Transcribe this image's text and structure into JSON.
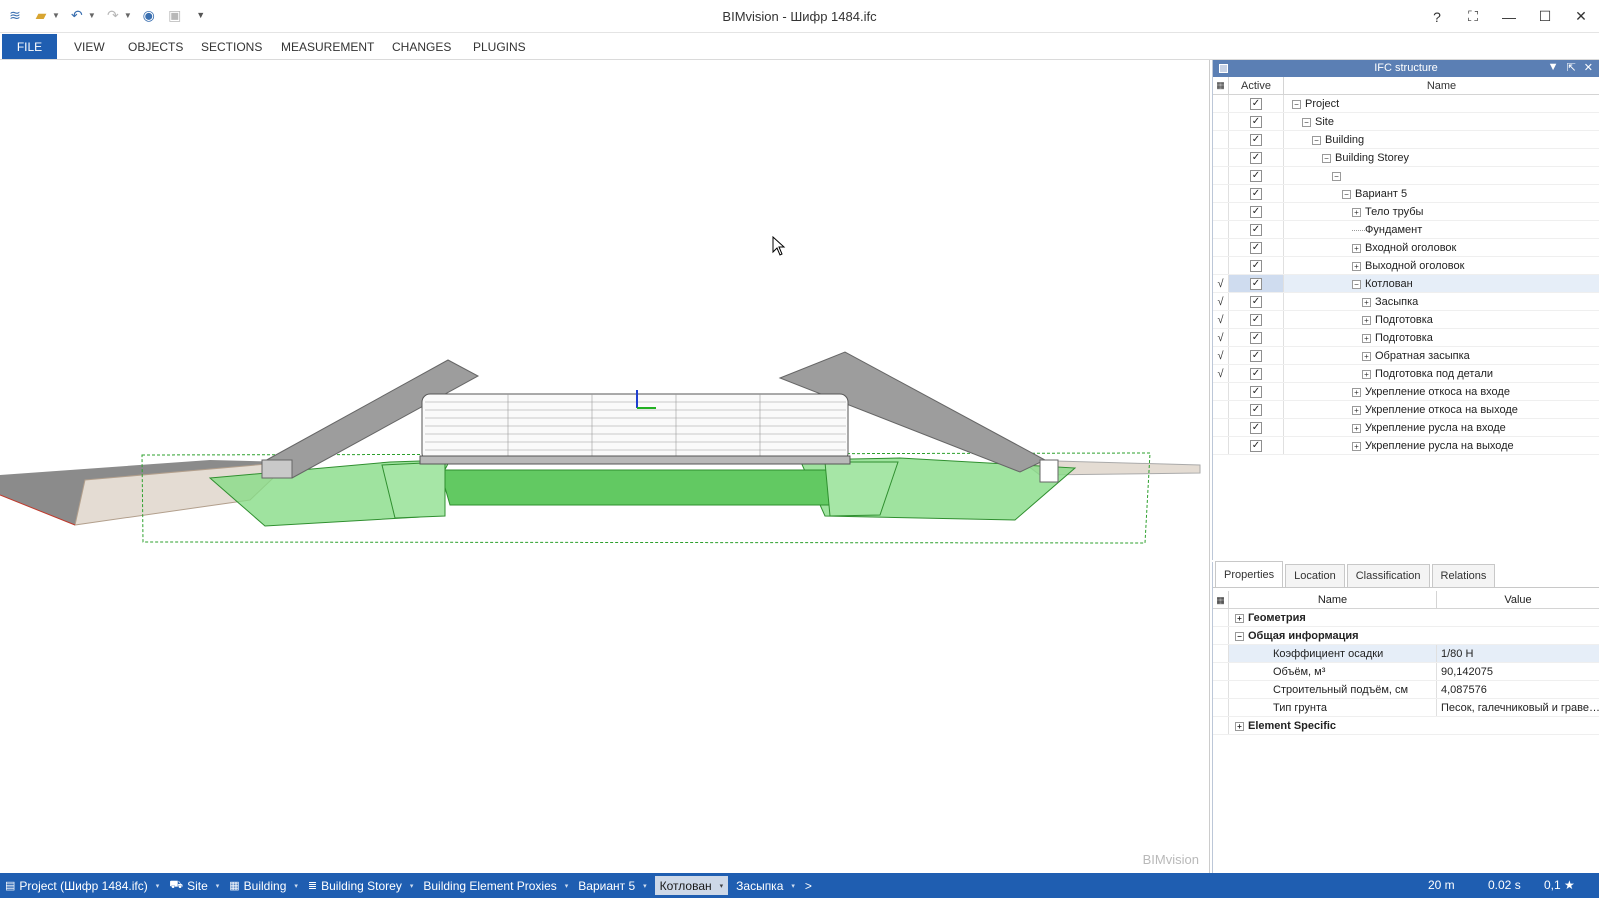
{
  "window": {
    "title": "BIMvision - Шифр 1484.ifc",
    "controls": {
      "help": "?",
      "fit": "⛶",
      "minimize": "—",
      "maximize": "☐",
      "close": "✕"
    }
  },
  "quick_access": [
    "app-icon",
    "open-icon",
    "undo-icon",
    "redo-icon",
    "settings-icon",
    "layout-icon",
    "customize-icon"
  ],
  "ribbon": {
    "file": "FILE",
    "tabs": [
      "VIEW",
      "OBJECTS",
      "SECTIONS",
      "MEASUREMENT",
      "CHANGES",
      "PLUGINS"
    ]
  },
  "viewport": {
    "watermark": "BIMvision"
  },
  "ifc_structure": {
    "title": "IFC structure",
    "columns": {
      "active": "Active",
      "name": "Name"
    },
    "rows": [
      {
        "name": "Project",
        "expander": "−",
        "mark": "",
        "active": true
      },
      {
        "name": "Site",
        "expander": "−",
        "mark": "",
        "active": true
      },
      {
        "name": "Building",
        "expander": "−",
        "mark": "",
        "active": true
      },
      {
        "name": "Building Storey",
        "expander": "−",
        "mark": "",
        "active": true
      },
      {
        "name": "",
        "expander": "−",
        "mark": "",
        "active": true
      },
      {
        "name": "Вариант 5",
        "expander": "−",
        "mark": "",
        "active": true
      },
      {
        "name": "Тело трубы",
        "expander": "+",
        "mark": "",
        "active": true
      },
      {
        "name": "Фундамент",
        "expander": "",
        "mark": "",
        "active": true
      },
      {
        "name": "Входной оголовок",
        "expander": "+",
        "mark": "",
        "active": true
      },
      {
        "name": "Выходной оголовок",
        "expander": "+",
        "mark": "",
        "active": true
      },
      {
        "name": "Котлован",
        "expander": "−",
        "mark": "√",
        "active": true
      },
      {
        "name": "Засыпка",
        "expander": "+",
        "mark": "√",
        "active": true
      },
      {
        "name": "Подготовка",
        "expander": "+",
        "mark": "√",
        "active": true
      },
      {
        "name": "Подготовка",
        "expander": "+",
        "mark": "√",
        "active": true
      },
      {
        "name": "Обратная засыпка",
        "expander": "+",
        "mark": "√",
        "active": true
      },
      {
        "name": "Подготовка под детали",
        "expander": "+",
        "mark": "√",
        "active": true
      },
      {
        "name": "Укрепление откоса на входе",
        "expander": "+",
        "mark": "",
        "active": true
      },
      {
        "name": "Укрепление откоса на выходе",
        "expander": "+",
        "mark": "",
        "active": true
      },
      {
        "name": "Укрепление русла на входе",
        "expander": "+",
        "mark": "",
        "active": true
      },
      {
        "name": "Укрепление русла на выходе",
        "expander": "+",
        "mark": "",
        "active": true
      }
    ]
  },
  "properties": {
    "tabs": [
      "Properties",
      "Location",
      "Classification",
      "Relations"
    ],
    "columns": {
      "name": "Name",
      "value": "Value"
    },
    "groups": [
      {
        "title": "Геометрия",
        "expander": "+",
        "items": []
      },
      {
        "title": "Общая информация",
        "expander": "−",
        "items": [
          {
            "name": "Коэффициент осадки",
            "value": "1/80 H"
          },
          {
            "name": "Объём, м³",
            "value": "90,142075"
          },
          {
            "name": "Строительный подъём, см",
            "value": "4,087576"
          },
          {
            "name": "Тип грунта",
            "value": "Песок, галечниковый и граве…"
          }
        ]
      },
      {
        "title": "Element Specific",
        "expander": "+",
        "items": []
      }
    ]
  },
  "statusbar": {
    "crumbs": [
      {
        "label": "Project (Шифр 1484.ifc)",
        "icon": "▤",
        "dd": "▾"
      },
      {
        "label": "Site",
        "icon": "⛟",
        "dd": "▾"
      },
      {
        "label": "Building",
        "icon": "▦",
        "dd": "▾"
      },
      {
        "label": "Building Storey",
        "icon": "≣",
        "dd": "▾"
      },
      {
        "label": "Building Element Proxies",
        "icon": "",
        "dd": "▾"
      },
      {
        "label": "Вариант 5",
        "icon": "",
        "dd": "▾"
      },
      {
        "label": "Котлован",
        "icon": "",
        "dd": "▾"
      },
      {
        "label": "Засыпка",
        "icon": "",
        "dd": "▾"
      },
      {
        "label": ">",
        "icon": "",
        "dd": ""
      }
    ],
    "scale": "20 m",
    "time": "0.02 s",
    "precision": "0,1 ★"
  },
  "colors": {
    "accent": "#1f5eb1",
    "panel_header": "#5b7fb4",
    "selection": "#e6eef8",
    "excavation": "#79d67a"
  }
}
